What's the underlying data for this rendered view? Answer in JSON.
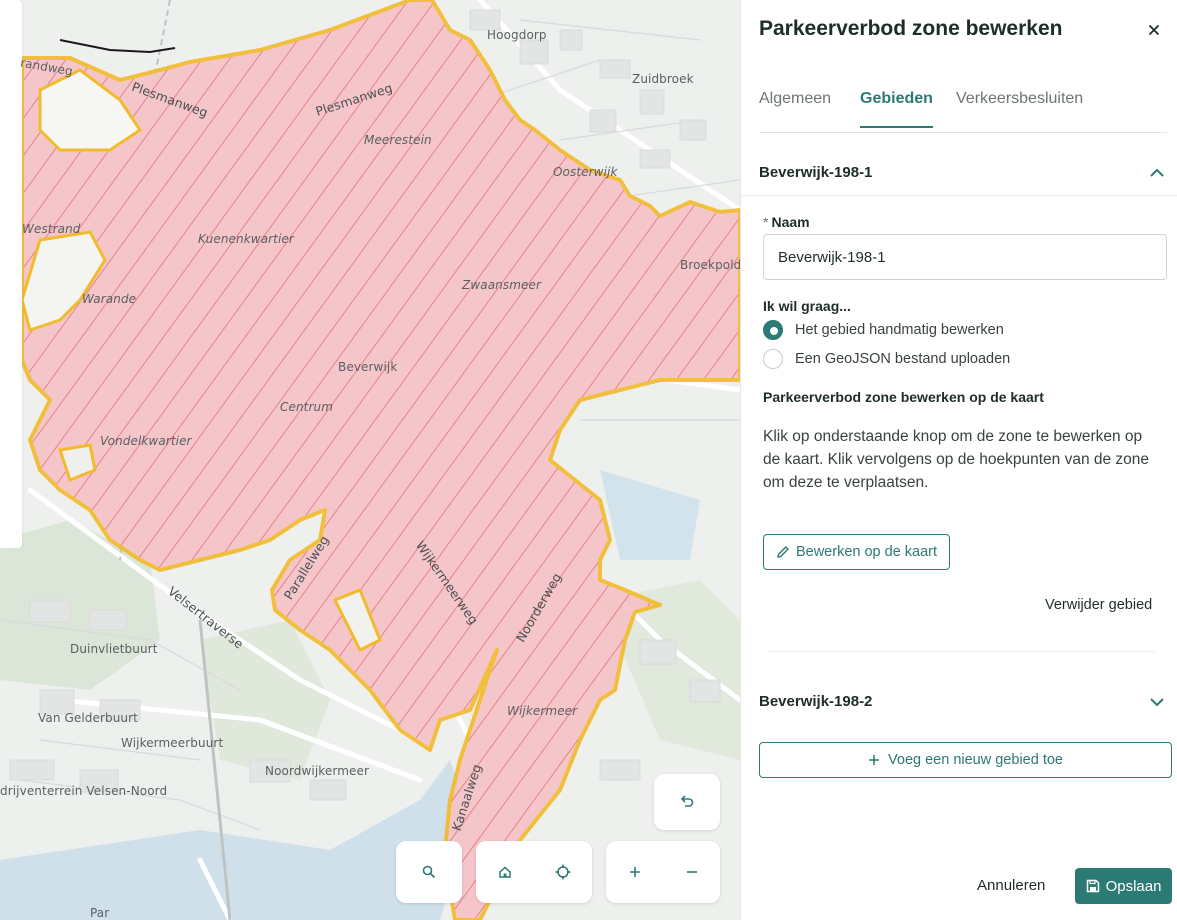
{
  "panel": {
    "title": "Parkeerverbod zone bewerken",
    "tabs": [
      "Algemeen",
      "Gebieden",
      "Verkeersbesluiten"
    ],
    "active_tab": "Gebieden",
    "area1": {
      "title": "Beverwijk-198-1",
      "name_label": "Naam",
      "name_required_mark": "*",
      "name_value": "Beverwijk-198-1",
      "choice_label": "Ik wil graag...",
      "option_manual": "Het gebied handmatig bewerken",
      "option_geojson": "Een GeoJSON bestand uploaden",
      "selected_option": "manual",
      "edit_heading": "Parkeerverbod zone bewerken op de kaart",
      "instructions": "Klik op onderstaande knop om de zone te bewerken op de kaart. Klik vervolgens op de hoekpunten van de zone om deze te verplaatsen.",
      "edit_button": "Bewerken op de kaart",
      "remove_link": "Verwijder gebied"
    },
    "area2": {
      "title": "Beverwijk-198-2"
    },
    "add_area_button": "Voeg een nieuw gebied toe",
    "cancel_button": "Annuleren",
    "save_button": "Opslaan"
  },
  "map": {
    "labels": {
      "hoogdorp": "Hoogdorp",
      "zuidbroek": "Zuidbroek",
      "plesmanweg1": "Plesmanweg",
      "plesmanweg2": "Plesmanweg",
      "meerestein": "Meerestein",
      "oosterwijk": "Oosterwijk",
      "westrand": "Westrand",
      "kuenenkwartier": "Kuenenkwartier",
      "broekpolder": "Broekpold",
      "zwaansmeer": "Zwaansmeer",
      "warande": "Warande",
      "beverwijk": "Beverwijk",
      "centrum": "Centrum",
      "vondelkwartier": "Vondelkwartier",
      "parallelweg": "Parallelweg",
      "wijkermeerweg": "Wijkermeerweg",
      "noorderweg": "Noorderweg",
      "velsertraverse": "Velsertraverse",
      "duinvlietbuurt": "Duinvlietbuurt",
      "van_gelderbuurt": "Van Gelderbuurt",
      "wijkermeerbuurt": "Wijkermeerbuurt",
      "noordwijkermeer": "Noordwijkermeer",
      "wijkermeer": "Wijkermeer",
      "bedrijventerrein": "drijventerrein Velsen-Noord",
      "kanaal": "Kanaalweg",
      "grandweg": "randweg",
      "par": "Par"
    },
    "controls": [
      "search-icon",
      "home-icon",
      "locate-icon",
      "zoom-in-icon",
      "zoom-out-icon",
      "undo-icon"
    ],
    "zone_fill": "#f4b4b8",
    "zone_stroke": "#f2bb2c",
    "hatch_color": "#e05a63"
  },
  "colors": {
    "accent": "#2b7a73"
  }
}
